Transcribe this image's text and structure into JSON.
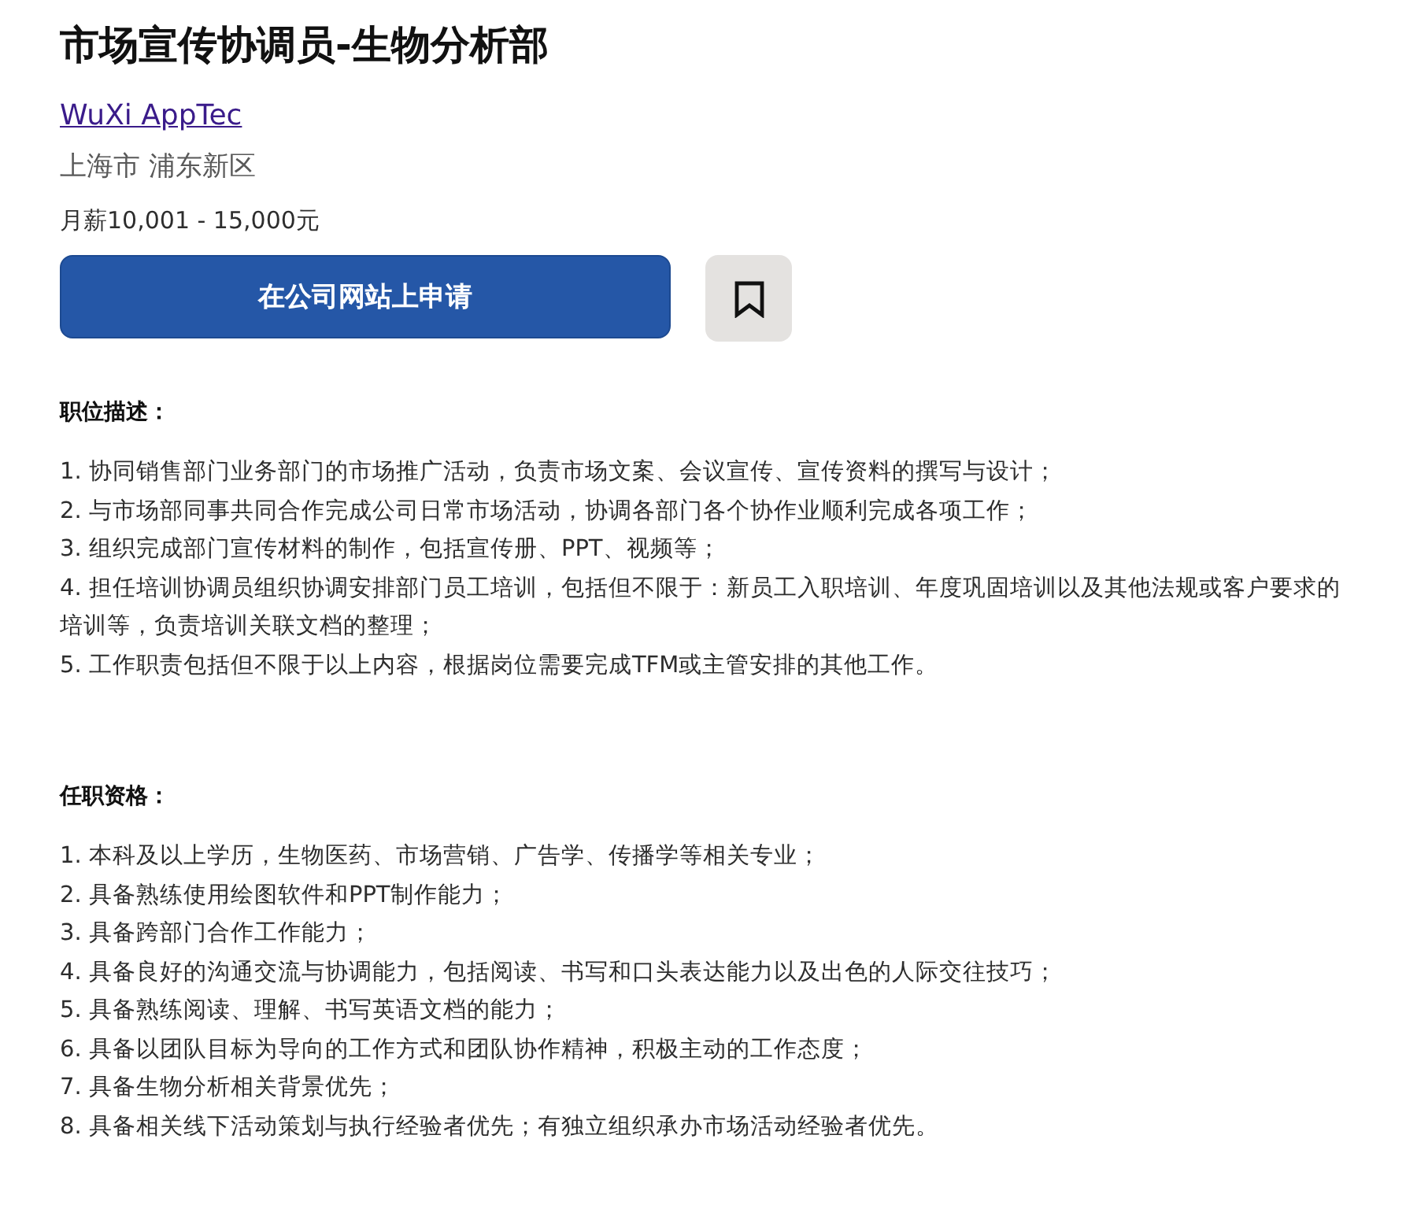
{
  "job": {
    "title": "市场宣传协调员-生物分析部",
    "company": "WuXi AppTec",
    "location": "上海市 浦东新区",
    "salary": "月薪10,001 - 15,000元"
  },
  "actions": {
    "apply": "在公司网站上申请",
    "saved": false
  },
  "sections": [
    {
      "heading": "职位描述：",
      "items": [
        "1. 协同销售部门业务部门的市场推广活动，负责市场文案、会议宣传、宣传资料的撰写与设计；",
        "2. 与市场部同事共同合作完成公司日常市场活动，协调各部门各个协作业顺利完成各项工作；",
        "3. 组织完成部门宣传材料的制作，包括宣传册、PPT、视频等；",
        "4. 担任培训协调员组织协调安排部门员工培训，包括但不限于：新员工入职培训、年度巩固培训以及其他法规或客户要求的培训等，负责培训关联文档的整理；",
        "5. 工作职责包括但不限于以上内容，根据岗位需要完成TFM或主管安排的其他工作。"
      ]
    },
    {
      "heading": "任职资格：",
      "items": [
        "1. 本科及以上学历，生物医药、市场营销、广告学、传播学等相关专业；",
        "2. 具备熟练使用绘图软件和PPT制作能力；",
        "3. 具备跨部门合作工作能力；",
        "4. 具备良好的沟通交流与协调能力，包括阅读、书写和口头表达能力以及出色的人际交往技巧；",
        "5. 具备熟练阅读、理解、书写英语文档的能力；",
        "6. 具备以团队目标为导向的工作方式和团队协作精神，积极主动的工作态度；",
        "7. 具备生物分析相关背景优先；",
        "8. 具备相关线下活动策划与执行经验者优先；有独立组织承办市场活动经验者优先。"
      ]
    }
  ]
}
